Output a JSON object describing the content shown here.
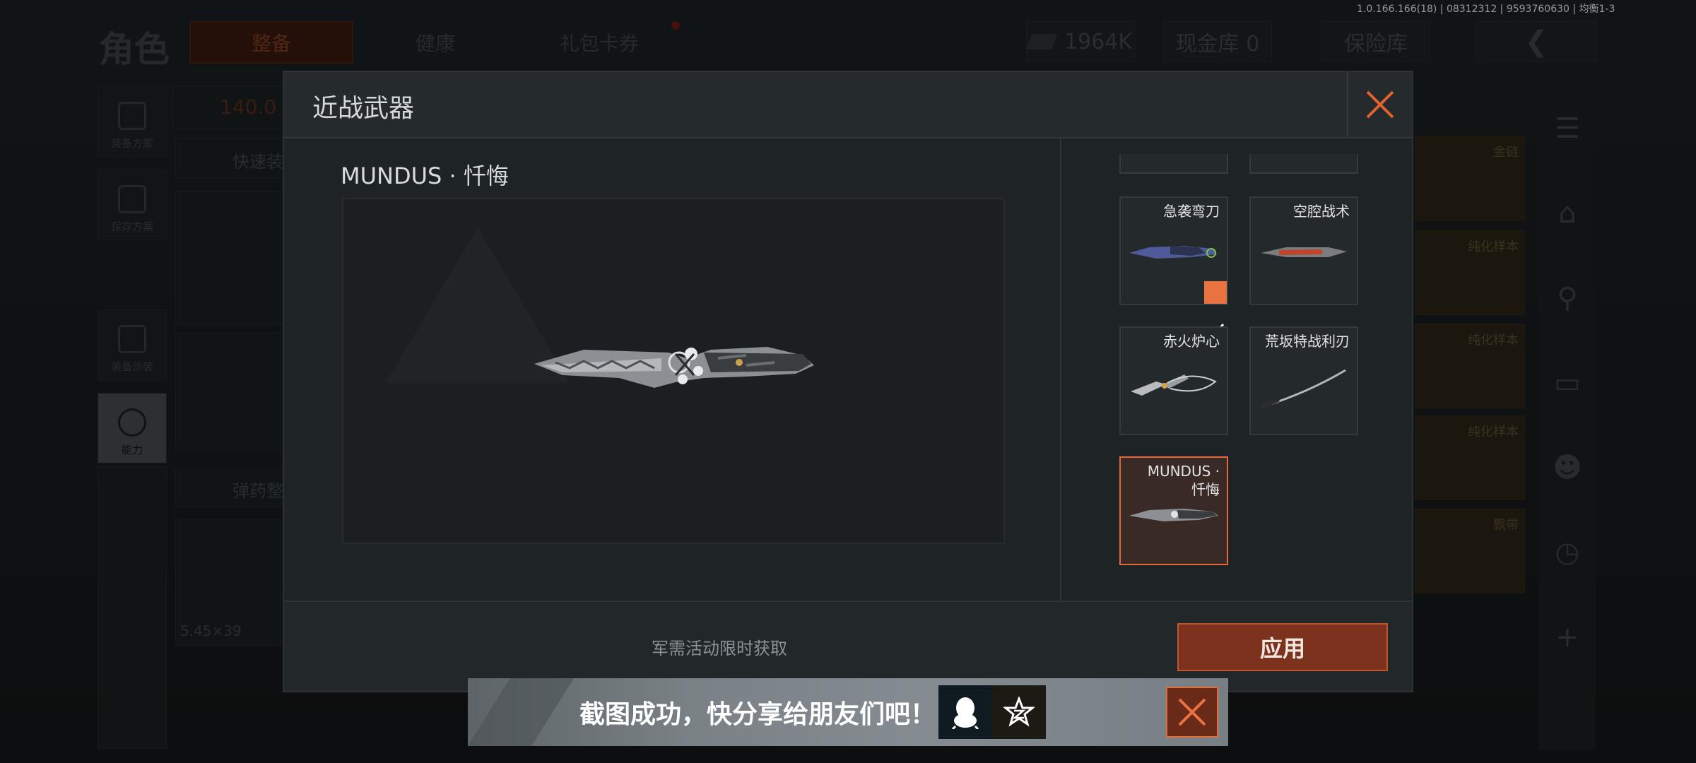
{
  "version_text": "1.0.166.166(18) | 08312312 | 9593760630 | 均衡1-3",
  "background": {
    "title": "角色",
    "tabs": [
      "整备",
      "健康",
      "礼包卡券"
    ],
    "currency": "1964K",
    "cash_vault": "现金库 0",
    "safe_box": "保险库",
    "nav": [
      "装备方案",
      "保存方案",
      "装备涂装",
      "能力"
    ],
    "weight": "140.0",
    "quick_equip": "快速装",
    "ammo_sort": "弹药整",
    "ammo_caliber": "5.45×39",
    "right_cards": [
      "金链",
      "纯化样本",
      "纯化样本",
      "纯化样本",
      "飘带"
    ]
  },
  "modal": {
    "title": "近战武器",
    "weapon_name": "MUNDUS · 忏悔",
    "items": [
      {
        "label": "急袭弯刀",
        "equipped": true
      },
      {
        "label": "空腔战术",
        "equipped": false
      },
      {
        "label": "赤火炉心",
        "equipped": false
      },
      {
        "label": "荒坂特战利刃",
        "equipped": false
      },
      {
        "label": "MUNDUS ·\n忏悔",
        "equipped": false,
        "selected": true
      }
    ],
    "acquire_text": "军需活动限时获取",
    "apply_label": "应用"
  },
  "toast": {
    "text": "截图成功，快分享给朋友们吧！"
  },
  "colors": {
    "accent": "#e8733e",
    "apply_bg": "#7c321c",
    "close": "#e0622f"
  }
}
